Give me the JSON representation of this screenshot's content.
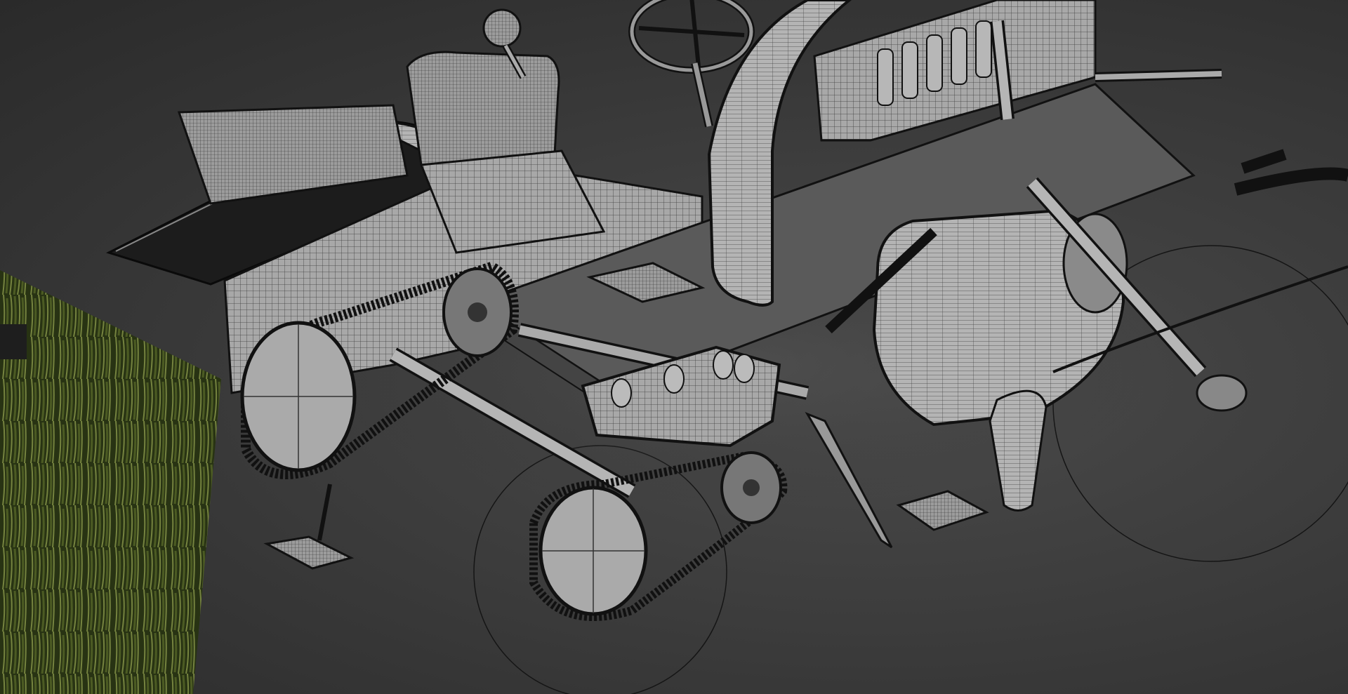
{
  "scene": {
    "background_color": "#3a3a3a",
    "wire_color": "#111111",
    "surface_color": "#a9a9a9",
    "foliage_colors": [
      "#2f3d17",
      "#5a6b2a",
      "#8a9a4a"
    ],
    "objects": [
      "3d-wireframe-vintage-car",
      "foliage-backdrop-plane",
      "front-chain-sprocket",
      "rear-chain-sprocket",
      "engine-cylinder",
      "steering-wheel",
      "seat",
      "fender",
      "pedal"
    ]
  }
}
